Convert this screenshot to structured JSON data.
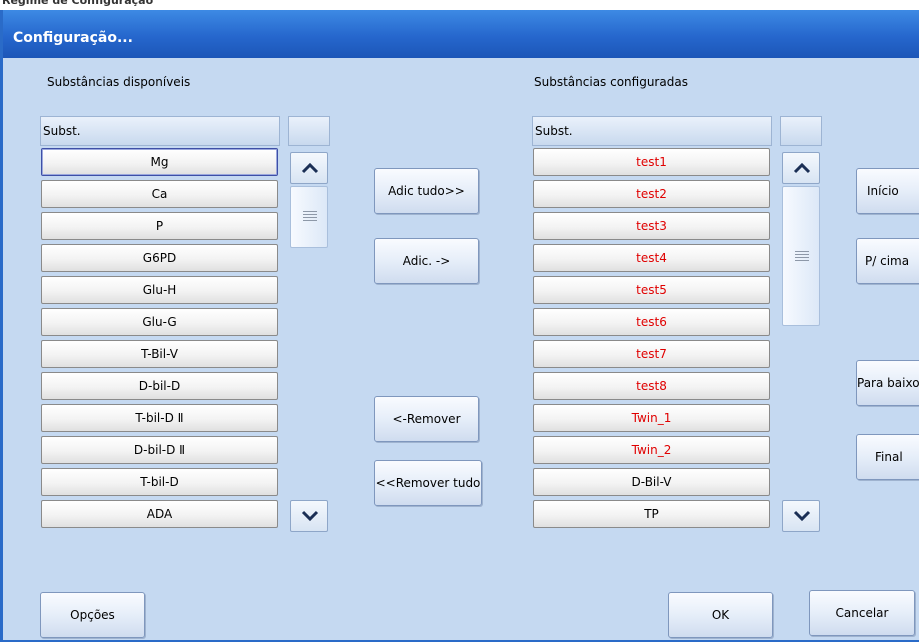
{
  "dialog": {
    "title": "Configuração..."
  },
  "available": {
    "label": "Substâncias disponíveis",
    "header": "Subst.",
    "items": [
      "Mg",
      "Ca",
      "P",
      "G6PD",
      "Glu-H",
      "Glu-G",
      "T-Bil-V",
      "D-bil-D",
      "T-bil-D Ⅱ",
      "D-bil-D Ⅱ",
      "T-bil-D",
      "ADA"
    ],
    "selected_index": 0
  },
  "configured": {
    "label": "Substâncias configuradas",
    "header": "Subst.",
    "items": [
      "test1",
      "test2",
      "test3",
      "test4",
      "test5",
      "test6",
      "test7",
      "test8",
      "Twin_1",
      "Twin_2",
      "D-Bil-V",
      "TP"
    ],
    "highlight_color": "#e00000",
    "highlighted_count": 10
  },
  "transfer_buttons": {
    "add_all": "Adic tudo>>",
    "add": "Adic. ->",
    "remove": "<-Remover",
    "remove_all": "<<Remover tudo"
  },
  "order_buttons": {
    "top": "Início",
    "up": "P/ cima",
    "down": "Para baixo",
    "bottom": "Final"
  },
  "footer": {
    "options": "Opções",
    "ok": "OK",
    "cancel": "Cancelar"
  },
  "icons": {
    "scroll_up": "chevron-up-icon",
    "scroll_down": "chevron-down-icon",
    "thumb_grip": "grip-icon"
  },
  "colors": {
    "titlebar": "#2667cd",
    "dialog_bg": "#c5d9f1"
  }
}
